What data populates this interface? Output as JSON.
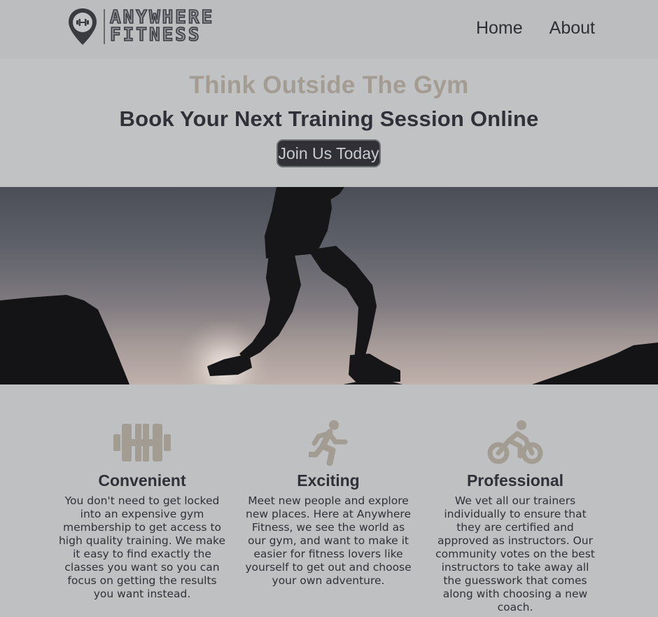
{
  "header": {
    "logo": {
      "line1": "ANYWHERE",
      "line2": "FITNESS"
    },
    "nav": [
      {
        "label": "Home"
      },
      {
        "label": "About"
      }
    ]
  },
  "hero": {
    "tagline": "Think Outside The Gym",
    "subtitle": "Book Your Next Training Session Online",
    "cta_label": "Join Us Today"
  },
  "features": [
    {
      "icon": "dumbbell-icon",
      "title": "Convenient",
      "text": "You don't need to get locked into an expensive gym membership to get access to high quality training. We make it easy to find exactly the classes you want so you can focus on getting the results you want instead."
    },
    {
      "icon": "running-person-icon",
      "title": "Exciting",
      "text": "Meet new people and explore new places. Here at Anywhere Fitness, we see the world as our gym, and want to make it easier for fitness lovers like yourself to get out and choose your own adventure."
    },
    {
      "icon": "cyclist-icon",
      "title": "Professional",
      "text": "We vet all our trainers individually to ensure that they are certified and approved as instructors. Our community votes on the best instructors to take away all the guesswork that comes along with choosing a new coach."
    }
  ],
  "colors": {
    "background": "#b9bbbc",
    "accent_tan": "#a39c93",
    "dark_text": "#303138",
    "button_bg": "#303036"
  }
}
